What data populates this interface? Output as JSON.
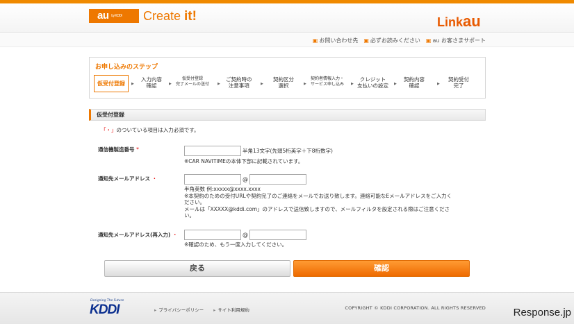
{
  "header": {
    "au_logo": "au",
    "kddi_small": "by KDDI",
    "brand_title_prefix": "Create ",
    "brand_title_suffix": "it!",
    "link_prefix": "Link",
    "link_suffix": "au",
    "accent_color": "#ee7800",
    "links": [
      "お問い合わせ先",
      "必ずお読みください",
      "au お客さまサポート"
    ]
  },
  "steps": {
    "title": "お申し込みのステップ",
    "items": [
      {
        "line1": "仮受付登録",
        "line2": ""
      },
      {
        "line1": "入力内容",
        "line2": "確認"
      },
      {
        "line1": "仮受付登録",
        "line2": "完了メールの送付"
      },
      {
        "line1": "ご契約時の",
        "line2": "注意事項"
      },
      {
        "line1": "契約区分",
        "line2": "選択"
      },
      {
        "line1": "契約者情報入力・",
        "line2": "サービス申し込み"
      },
      {
        "line1": "クレジット",
        "line2": "支払いの設定"
      },
      {
        "line1": "契約内容",
        "line2": "確認"
      },
      {
        "line1": "契約受付",
        "line2": "完了"
      }
    ]
  },
  "form": {
    "section_title": "仮受付登録",
    "required_mark": "「・」",
    "required_note": "のついている項目は入力必須です。",
    "device_serial": {
      "label": "通信機製造番号",
      "req": "*",
      "value": "",
      "hint": "半角13文字(先頭5桁英字＋下8桁数字)",
      "note": "※CAR NAVITIMEの本体下部に記載されています。"
    },
    "email": {
      "label": "通知先メールアドレス",
      "req": "・",
      "local_value": "",
      "domain_value": "",
      "at": "@",
      "hint1": "半角英数 例:xxxxx@xxxx.xxxx",
      "hint2": "※本契約のための受付URLや契約完了のご連絡をメールでお送り致します。連絡可能なEメールアドレスをご入力く",
      "hint3": "ださい。",
      "hint4": "メールは「XXXXX@kddi.com」のアドレスで送信致しますので、メールフィルタを設定される際はご注意くださ",
      "hint5": "い。"
    },
    "email_confirm": {
      "label": "通知先メールアドレス(再入力)",
      "req": "・",
      "local_value": "",
      "domain_value": "",
      "at": "@",
      "note": "※確認のため、もう一度入力してください。"
    }
  },
  "buttons": {
    "back": "戻る",
    "confirm": "確認"
  },
  "footer": {
    "kddi_tagline": "Designing The Future",
    "kddi_logo": "KDDI",
    "links": [
      "プライバシーポリシー",
      "サイト利用規約"
    ],
    "copyright": "COPYRIGHT © KDDI CORPORATION. ALL RIGHTS RESERVED"
  },
  "watermark": "Response.jp"
}
